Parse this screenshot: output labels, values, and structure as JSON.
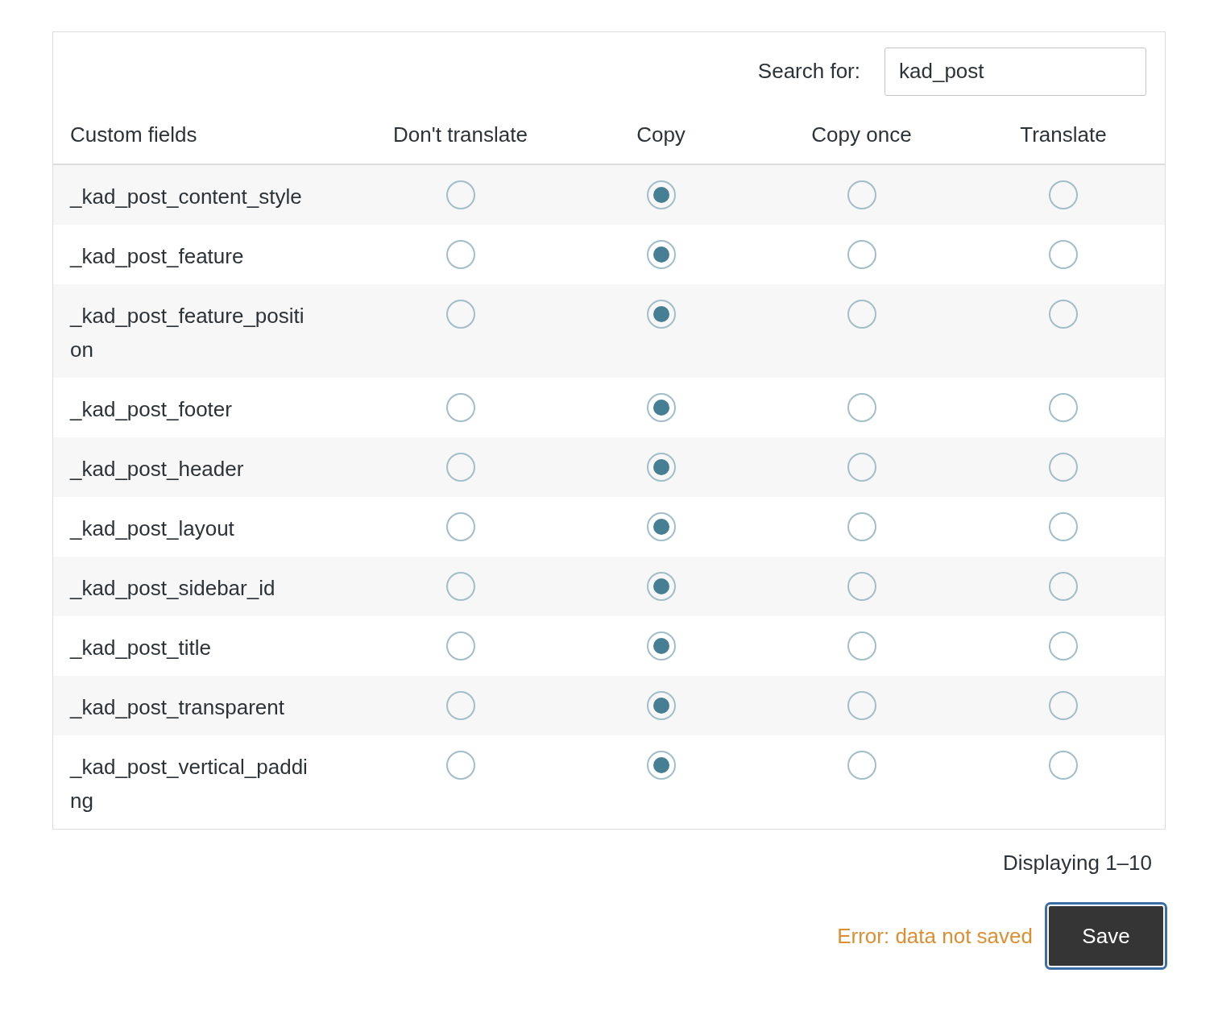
{
  "search": {
    "label": "Search for:",
    "value": "kad_post"
  },
  "table": {
    "columns": [
      "Custom fields",
      "Don't translate",
      "Copy",
      "Copy once",
      "Translate"
    ],
    "rows": [
      {
        "name": "_kad_post_content_style",
        "options": [
          {
            "selected": false
          },
          {
            "selected": true
          },
          {
            "selected": false
          },
          {
            "selected": false
          }
        ]
      },
      {
        "name": "_kad_post_feature",
        "options": [
          {
            "selected": false
          },
          {
            "selected": true
          },
          {
            "selected": false
          },
          {
            "selected": false
          }
        ]
      },
      {
        "name": "_kad_post_feature_position",
        "options": [
          {
            "selected": false
          },
          {
            "selected": true
          },
          {
            "selected": false
          },
          {
            "selected": false
          }
        ]
      },
      {
        "name": "_kad_post_footer",
        "options": [
          {
            "selected": false
          },
          {
            "selected": true
          },
          {
            "selected": false
          },
          {
            "selected": false
          }
        ]
      },
      {
        "name": "_kad_post_header",
        "options": [
          {
            "selected": false
          },
          {
            "selected": true
          },
          {
            "selected": false
          },
          {
            "selected": false
          }
        ]
      },
      {
        "name": "_kad_post_layout",
        "options": [
          {
            "selected": false
          },
          {
            "selected": true
          },
          {
            "selected": false
          },
          {
            "selected": false
          }
        ]
      },
      {
        "name": "_kad_post_sidebar_id",
        "options": [
          {
            "selected": false
          },
          {
            "selected": true
          },
          {
            "selected": false
          },
          {
            "selected": false
          }
        ]
      },
      {
        "name": "_kad_post_title",
        "options": [
          {
            "selected": false
          },
          {
            "selected": true
          },
          {
            "selected": false
          },
          {
            "selected": false
          }
        ]
      },
      {
        "name": "_kad_post_transparent",
        "options": [
          {
            "selected": false
          },
          {
            "selected": true
          },
          {
            "selected": false
          },
          {
            "selected": false
          }
        ]
      },
      {
        "name": "_kad_post_vertical_padding",
        "options": [
          {
            "selected": false
          },
          {
            "selected": true
          },
          {
            "selected": false
          },
          {
            "selected": false
          }
        ]
      }
    ]
  },
  "pagination": "Displaying 1–10",
  "error": "Error: data not saved",
  "save_button": "Save"
}
